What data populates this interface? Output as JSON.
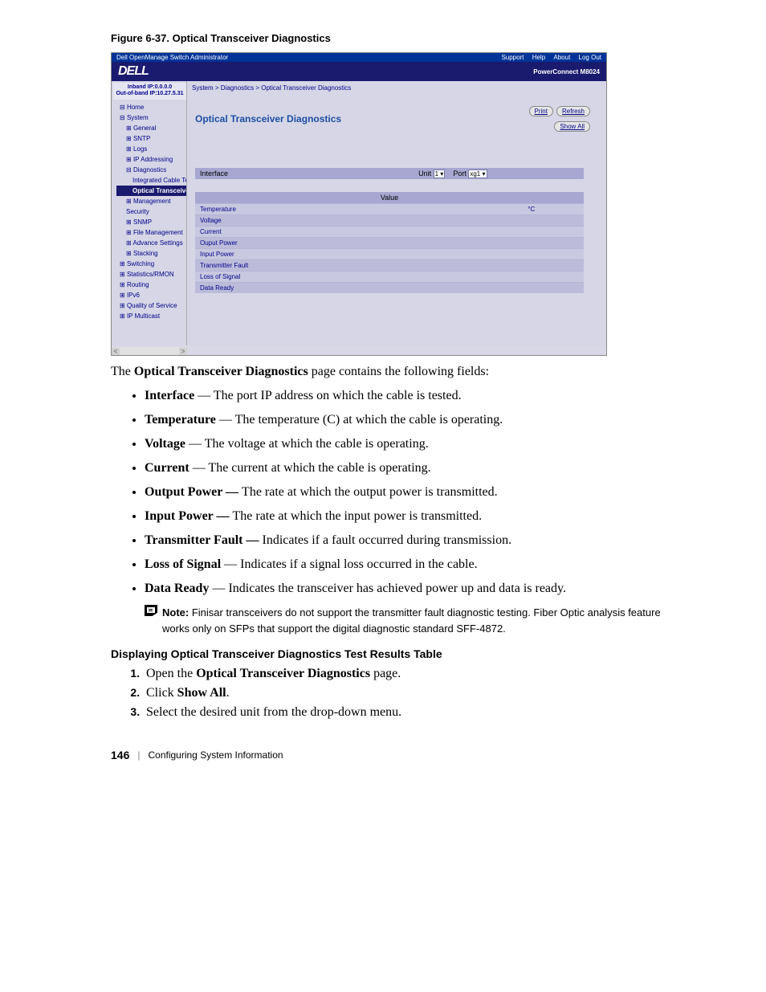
{
  "figure_caption": "Figure 6-37.    Optical Transceiver Diagnostics",
  "screenshot": {
    "titlebar_left": "Dell OpenManage Switch Administrator",
    "titlebar_links": [
      "Support",
      "Help",
      "About",
      "Log Out"
    ],
    "logo": "DELL",
    "header_right": "PowerConnect M8024",
    "ip_line1": "Inband IP:0.0.0.0",
    "ip_line2": "Out-of-band IP:10.27.5.31",
    "tree": {
      "home": "Home",
      "system": "System",
      "general": "General",
      "sntp": "SNTP",
      "logs": "Logs",
      "ip_addressing": "IP Addressing",
      "diagnostics": "Diagnostics",
      "integrated_cable": "Integrated Cable Te",
      "optical_trans": "Optical Transceive",
      "mgmt_security": "Management Security",
      "snmp": "SNMP",
      "file_mgmt": "File Management",
      "advance": "Advance Settings",
      "stacking": "Stacking",
      "switching": "Switching",
      "stats": "Statistics/RMON",
      "routing": "Routing",
      "ipv6": "IPv6",
      "qos": "Quality of Service",
      "ipmcast": "IP Multicast"
    },
    "breadcrumb": "System > Diagnostics > Optical Transceiver Diagnostics",
    "page_title": "Optical Transceiver Diagnostics",
    "btn_print": "Print",
    "btn_refresh": "Refresh",
    "btn_showall": "Show All",
    "if_label": "Interface",
    "unit_label": "Unit",
    "unit_val": "1",
    "port_label": "Port",
    "port_val": "xg1",
    "value_header": "Value",
    "rows": {
      "temp": "Temperature",
      "temp_unit": "°C",
      "voltage": "Voltage",
      "current": "Current",
      "output": "Ouput Power",
      "input": "Input Power",
      "tx_fault": "Transmitter Fault",
      "los": "Loss of Signal",
      "dataready": "Data Ready"
    }
  },
  "intro": {
    "pre": "The ",
    "term": "Optical Transceiver Diagnostics",
    "post": " page contains the following fields:"
  },
  "fields": [
    {
      "term": "Interface",
      "sep": " — ",
      "desc": "The port IP address on which the cable is tested."
    },
    {
      "term": "Temperature",
      "sep": " — ",
      "desc": "The temperature (C) at which the cable is operating."
    },
    {
      "term": "Voltage",
      "sep": " — ",
      "desc": "The voltage at which the cable is operating."
    },
    {
      "term": "Current",
      "sep": " — ",
      "desc": "The current at which the cable is operating."
    },
    {
      "term": "Output Power — ",
      "sep": "",
      "desc": "The rate at which the output power is transmitted."
    },
    {
      "term": "Input Power — ",
      "sep": "",
      "desc": "The rate at which the input power is transmitted."
    },
    {
      "term": "Transmitter Fault — ",
      "sep": "",
      "desc": "Indicates if a fault occurred during transmission."
    },
    {
      "term": "Loss of Signal",
      "sep": " — ",
      "desc": "Indicates if a signal loss occurred in the cable."
    },
    {
      "term": "Data Ready",
      "sep": " — ",
      "desc": "Indicates the transceiver has achieved power up and data is ready."
    }
  ],
  "note": {
    "label": "Note: ",
    "text": "Finisar transceivers do not support the transmitter fault diagnostic testing. Fiber Optic analysis feature works only on SFPs that support the digital diagnostic standard SFF-4872."
  },
  "subheading": "Displaying Optical Transceiver Diagnostics Test Results Table",
  "steps": {
    "s1a": "Open the ",
    "s1b": "Optical Transceiver Diagnostics",
    "s1c": " page.",
    "s2a": "Click ",
    "s2b": "Show All",
    "s2c": ".",
    "s3": "Select the desired unit from the drop-down menu."
  },
  "footer": {
    "page": "146",
    "section": "Configuring System Information"
  }
}
